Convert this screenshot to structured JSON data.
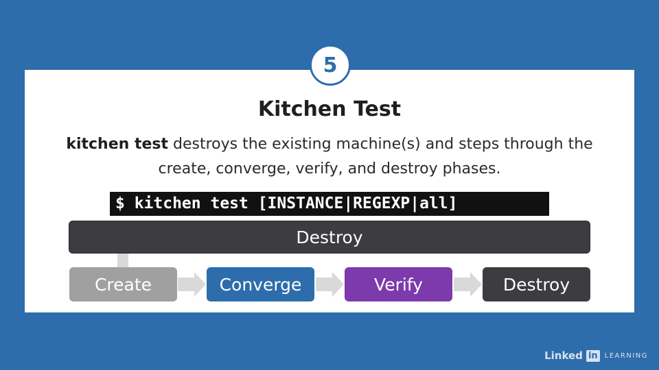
{
  "step": {
    "number": "5"
  },
  "slide": {
    "title": "Kitchen Test",
    "description_bold": "kitchen test",
    "description_rest": " destroys the existing machine(s) and steps through the create, converge, verify, and destroy phases.",
    "command": "$ kitchen test [INSTANCE|REGEXP|all]"
  },
  "flow": {
    "top_bar": "Destroy",
    "phases": [
      "Create",
      "Converge",
      "Verify",
      "Destroy"
    ]
  },
  "colors": {
    "background": "#2d6dab",
    "create": "#a0a0a0",
    "converge": "#2d6dab",
    "verify": "#7d3aad",
    "destroy": "#3c3c41",
    "arrow": "#d9d9d9"
  },
  "branding": {
    "wordmark": "Linked",
    "badge": "in",
    "suffix": "LEARNING"
  }
}
